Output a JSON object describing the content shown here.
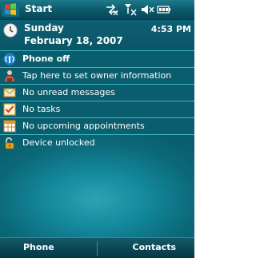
{
  "title_bar": {
    "start_label": "Start",
    "status_icons": [
      "data-connection-icon",
      "signal-off-icon",
      "volume-muted-icon",
      "battery-icon"
    ]
  },
  "header": {
    "day": "Sunday",
    "date": "February 18, 2007",
    "time": "4:53 PM"
  },
  "today_items": [
    {
      "label": "Phone off",
      "icon": "phone-antenna-icon",
      "bold": true
    },
    {
      "label": "Tap here to set owner information",
      "icon": "owner-icon"
    },
    {
      "label": "No unread messages",
      "icon": "envelope-icon"
    },
    {
      "label": "No tasks",
      "icon": "tasks-checkbox-icon"
    },
    {
      "label": "No upcoming appointments",
      "icon": "calendar-icon"
    },
    {
      "label": "Device unlocked",
      "icon": "padlock-open-icon"
    }
  ],
  "softkeys": {
    "left": "Phone",
    "right": "Contacts"
  },
  "colors": {
    "background": "#0b6878",
    "separator": "#3cb6c7",
    "text": "#ffffff"
  }
}
